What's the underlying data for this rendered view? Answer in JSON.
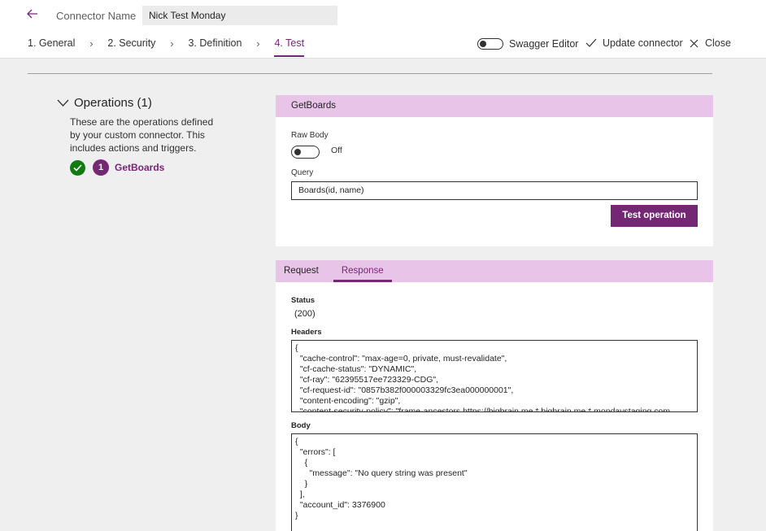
{
  "header": {
    "connector_label": "Connector Name",
    "connector_name": "Nick Test Monday"
  },
  "steps": [
    {
      "label": "1. General"
    },
    {
      "label": "2. Security"
    },
    {
      "label": "3. Definition"
    },
    {
      "label": "4. Test"
    }
  ],
  "toolbar": {
    "swagger_label": "Swagger Editor",
    "update_label": "Update connector",
    "close_label": "Close"
  },
  "operations": {
    "title": "Operations (1)",
    "description": "These are the operations defined by your custom connector. This includes actions and triggers.",
    "item_number": "1",
    "item_label": "GetBoards"
  },
  "test_card": {
    "title": "GetBoards",
    "raw_body_label": "Raw Body",
    "raw_body_state": "Off",
    "query_label": "Query",
    "query_value": "Boards(id, name)",
    "test_button": "Test operation"
  },
  "response_card": {
    "tab_request": "Request",
    "tab_response": "Response",
    "status_label": "Status",
    "status_value": "(200)",
    "headers_label": "Headers",
    "headers_text": "{\n  \"cache-control\": \"max-age=0, private, must-revalidate\",\n  \"cf-cache-status\": \"DYNAMIC\",\n  \"cf-ray\": \"62395517ee723329-CDG\",\n  \"cf-request-id\": \"0857b382f000003329fc3ea000000001\",\n  \"content-encoding\": \"gzip\",\n  \"content-security-policy\": \"frame-ancestors https://bigbrain.me *.bigbrain.me *.mondaystaging.com",
    "body_label": "Body",
    "body_text": "{\n  \"errors\": [\n    {\n      \"message\": \"No query string was present\"\n    }\n  ],\n  \"account_id\": 3376900\n}"
  },
  "colors": {
    "accent": "#742774",
    "header_band": "#e8c5e8",
    "success": "#107c10"
  }
}
